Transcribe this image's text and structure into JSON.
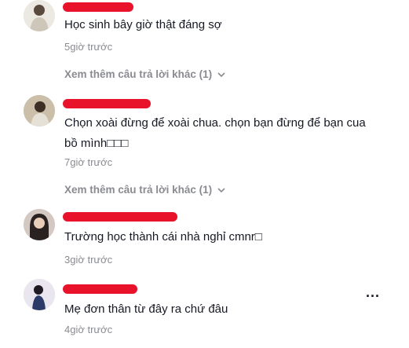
{
  "comments": [
    {
      "text": "Học sinh bây giờ thật đáng sợ",
      "time": "5giờ trước",
      "more_replies": "Xem thêm câu trả lời khác (1)"
    },
    {
      "text_line1": "Chọn xoài đừng để xoài chua. chọn bạn đừng để bạn cua",
      "text_line2": "bồ mình□□□",
      "time": "7giờ trước",
      "more_replies": "Xem thêm câu trả lời khác (1)"
    },
    {
      "text": "Trường học thành cái nhà nghỉ cmnr□",
      "time": "3giờ trước"
    },
    {
      "text": "Mẹ đơn thân từ đây ra chứ đâu",
      "time": "4giờ trước",
      "options": "..."
    }
  ],
  "colors": {
    "redaction": "#e8132a",
    "secondary_text": "#8a8b91",
    "primary_text": "#161823"
  }
}
